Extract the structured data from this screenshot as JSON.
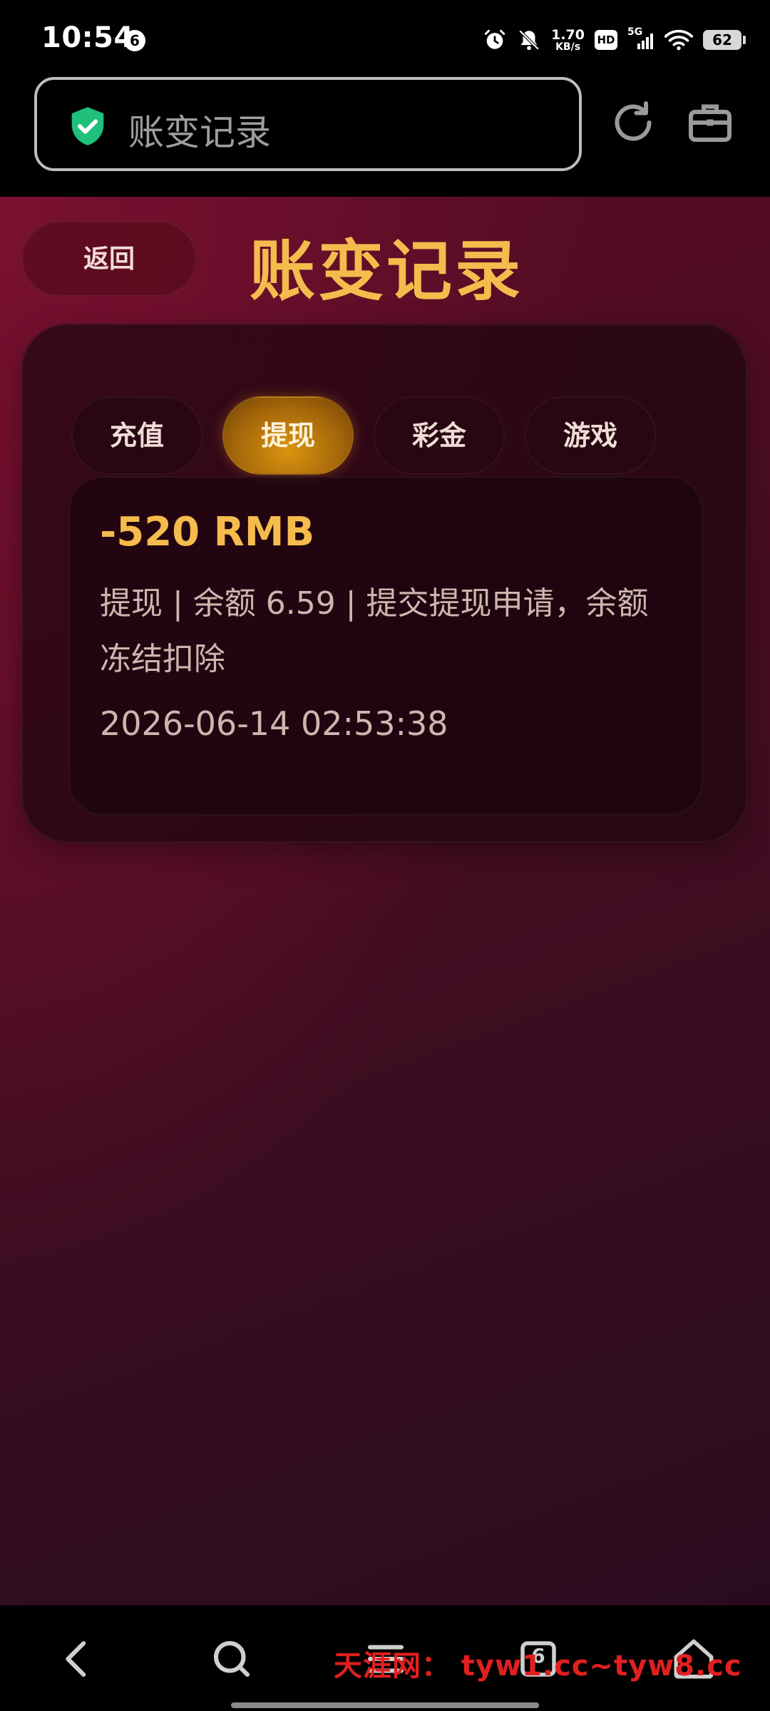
{
  "status_bar": {
    "time": "10:54",
    "notification_count": "6",
    "net_speed_value": "1.70",
    "net_speed_unit": "KB/s",
    "hd_label": "HD",
    "signal_label": "5G",
    "battery": "62"
  },
  "browser": {
    "address_text": "账变记录",
    "icons": [
      "shield-check-icon",
      "refresh-icon",
      "toolbox-icon"
    ]
  },
  "page": {
    "back_label": "返回",
    "title": "账变记录",
    "tabs": [
      {
        "label": "充值",
        "active": false
      },
      {
        "label": "提现",
        "active": true
      },
      {
        "label": "彩金",
        "active": false
      },
      {
        "label": "游戏",
        "active": false
      }
    ],
    "records": [
      {
        "amount": "-520 RMB",
        "detail": "提现 | 余额 6.59 | 提交提现申请，余额冻结扣除",
        "time": "2026-06-14 02:53:38"
      }
    ],
    "colors": {
      "accent": "#f4bc4c",
      "active_tab": "#c98a0e",
      "background": "#4a0d22"
    }
  },
  "bottom_nav": {
    "icons": [
      "back-icon",
      "search-icon",
      "menu-icon",
      "tabs-icon",
      "home-icon"
    ],
    "tab_count": "6",
    "watermark": "天涯网： tyw1.cc~tyw8.cc"
  }
}
